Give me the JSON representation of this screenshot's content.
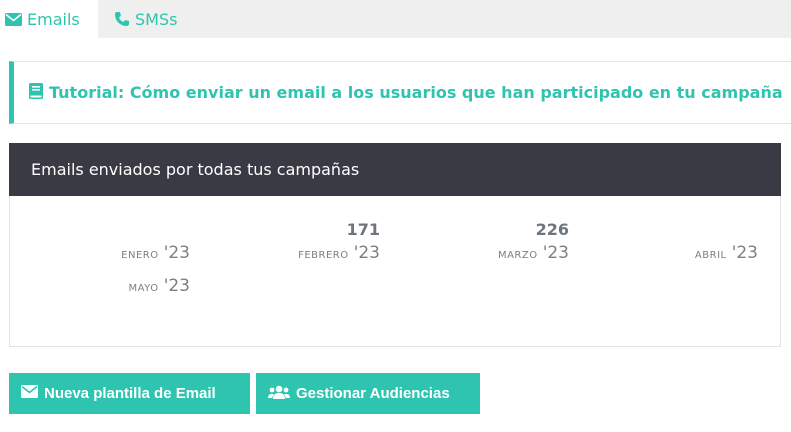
{
  "tabs": [
    {
      "label": "Emails",
      "icon": "envelope-icon",
      "active": true
    },
    {
      "label": "SMSs",
      "icon": "phone-icon",
      "active": false
    }
  ],
  "tutorial": {
    "icon": "book-icon",
    "text": "Tutorial: Cómo enviar un email a los usuarios que han participado en tu campaña"
  },
  "panel": {
    "title": "Emails enviados por todas tus campañas",
    "months": [
      {
        "name": "Enero",
        "year": "'23",
        "value": ""
      },
      {
        "name": "Febrero",
        "year": "'23",
        "value": "171"
      },
      {
        "name": "Marzo",
        "year": "'23",
        "value": "226"
      },
      {
        "name": "Abril",
        "year": "'23",
        "value": ""
      },
      {
        "name": "Mayo",
        "year": "'23",
        "value": ""
      }
    ]
  },
  "buttons": {
    "new_template": "Nueva plantilla de Email",
    "manage_audiences": "Gestionar Audiencias"
  },
  "colors": {
    "accent": "#2ec4b0",
    "header_dark": "#3a3a45"
  }
}
